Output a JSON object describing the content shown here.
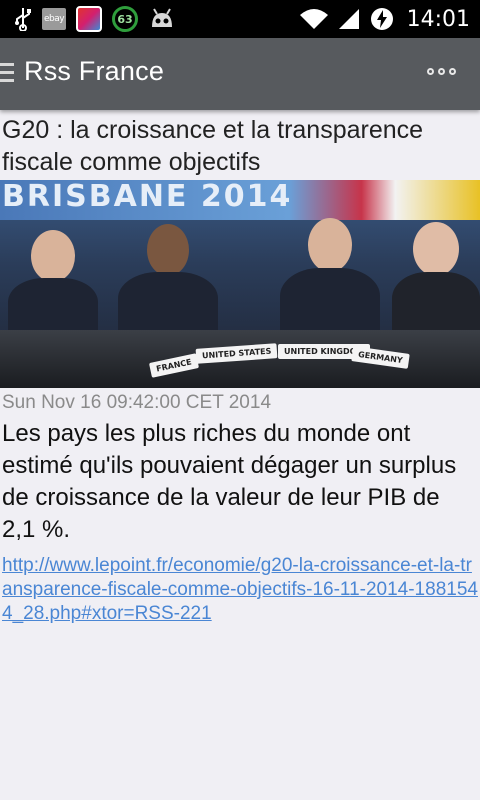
{
  "status_bar": {
    "time": "14:01",
    "ebay_label": "ebay",
    "badge_count": "63",
    "icons": [
      "usb-icon",
      "ebay-icon",
      "game-icon",
      "badge-63-icon",
      "android-icon",
      "wifi-icon",
      "signal-icon",
      "battery-charging-icon"
    ]
  },
  "app_bar": {
    "title": "Rss France",
    "menu_icon": "hamburger-icon",
    "overflow_icon": "overflow-dots-icon"
  },
  "article": {
    "title": "G20 : la croissance et la transparence fiscale comme objectifs",
    "image": {
      "banner_text": "BRISBANE 2014",
      "nameplates": [
        "FRANCE",
        "UNITED STATES",
        "UNITED KINGDOM",
        "GERMANY"
      ]
    },
    "date": "Sun Nov 16 09:42:00 CET 2014",
    "summary": "Les pays les plus riches du monde ont estimé qu'ils pouvaient dégager un surplus de croissance de la valeur de leur PIB de 2,1 %.",
    "link": "http://www.lepoint.fr/economie/g20-la-croissance-et-la-transparence-fiscale-comme-objectifs-16-11-2014-1881544_28.php#xtor=RSS-221"
  },
  "colors": {
    "app_bar": "#575a5e",
    "background": "#f0eff4",
    "link": "#4a86d4",
    "date": "#8a8a8a"
  }
}
